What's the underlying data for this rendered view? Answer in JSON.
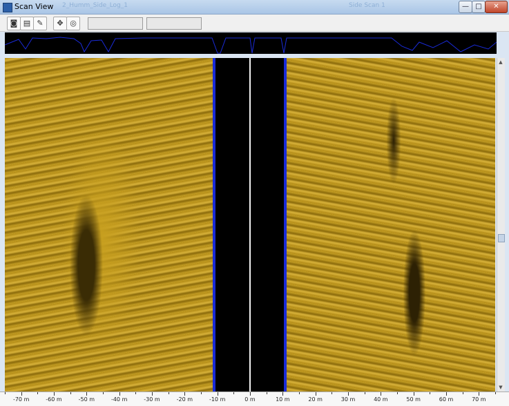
{
  "window": {
    "title": "Scan View",
    "background_tabs": [
      "2_Humm_Side_Log_1",
      "Side Scan 1"
    ]
  },
  "window_controls": {
    "minimize": "—",
    "maximize": "□",
    "close": "✕"
  },
  "toolbar": {
    "buttons": [
      "camera-icon",
      "print-icon",
      "pen-icon",
      "target-icon",
      "settings-icon"
    ],
    "field1": "",
    "field2": ""
  },
  "colors": {
    "sonar_gold": "#c9a226",
    "water_column": "#000000",
    "bottom_trace": "#1a2bd8",
    "depth_trace": "#1a2bd8"
  },
  "ruler": {
    "labels": [
      "-70 m",
      "-60 m",
      "-50 m",
      "-40 m",
      "-30 m",
      "-20 m",
      "-10 m",
      "0 m",
      "10 m",
      "20 m",
      "30 m",
      "40 m",
      "50 m",
      "60 m",
      "70 m"
    ],
    "min": -75,
    "max": 75
  }
}
